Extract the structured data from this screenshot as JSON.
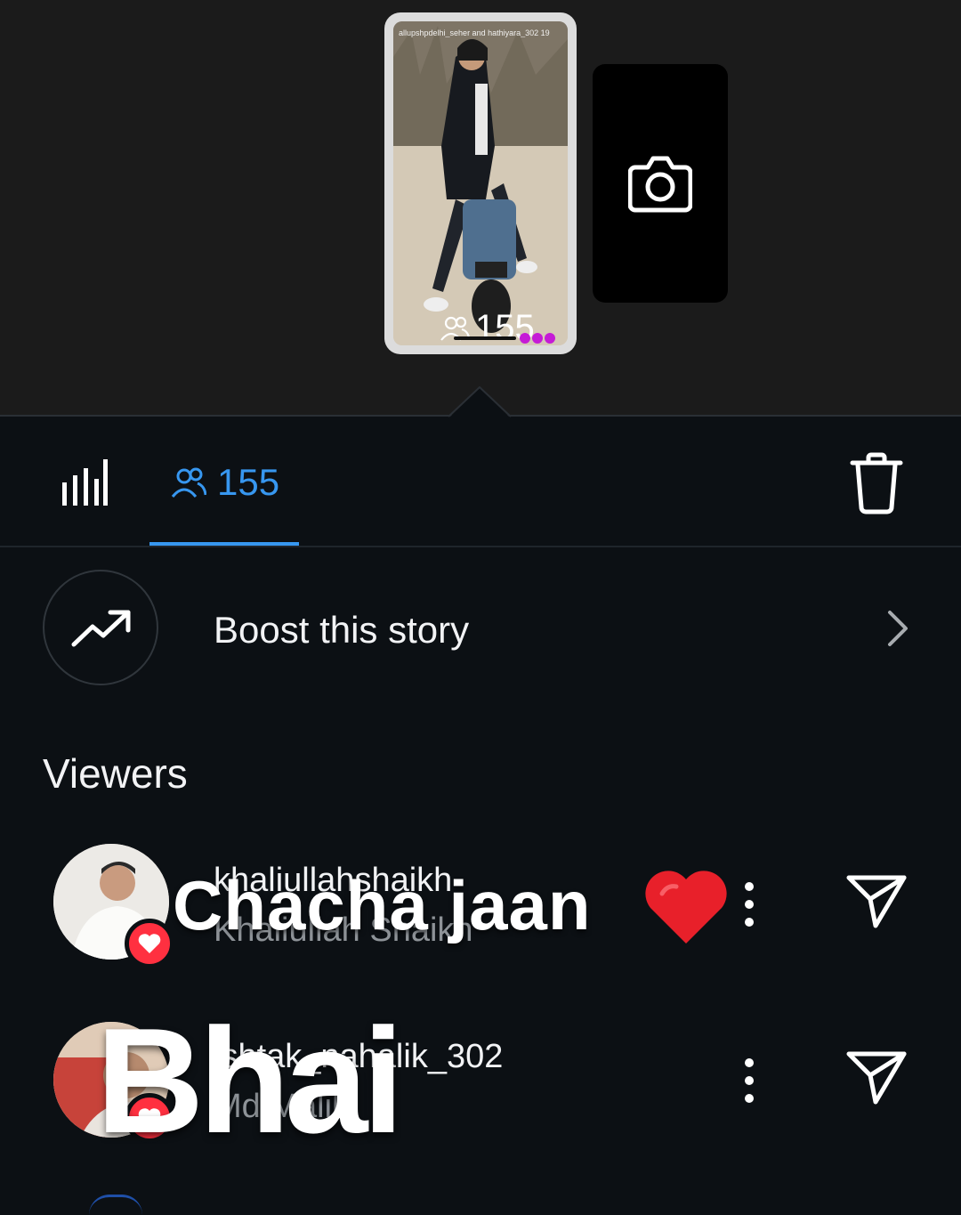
{
  "story": {
    "caption": "allupshpdelhi_seher and hathiyara_302 19",
    "viewer_count": "155"
  },
  "tabs": {
    "viewers_count": "155"
  },
  "boost": {
    "label": "Boost this story"
  },
  "viewers_title": "Viewers",
  "viewers": [
    {
      "username": "khaliullahshaikh",
      "full_name": "Khaliullah Shaikh",
      "liked": true
    },
    {
      "username": "ishtak_nahalik_302",
      "full_name": "Md Malik",
      "liked": true
    }
  ],
  "overlays": {
    "chacha_text": "Chacha jaan",
    "bhai_text": "Bhai"
  },
  "colors": {
    "accent": "#3797f0",
    "like": "#ff3040",
    "heart": "#e8202a"
  }
}
